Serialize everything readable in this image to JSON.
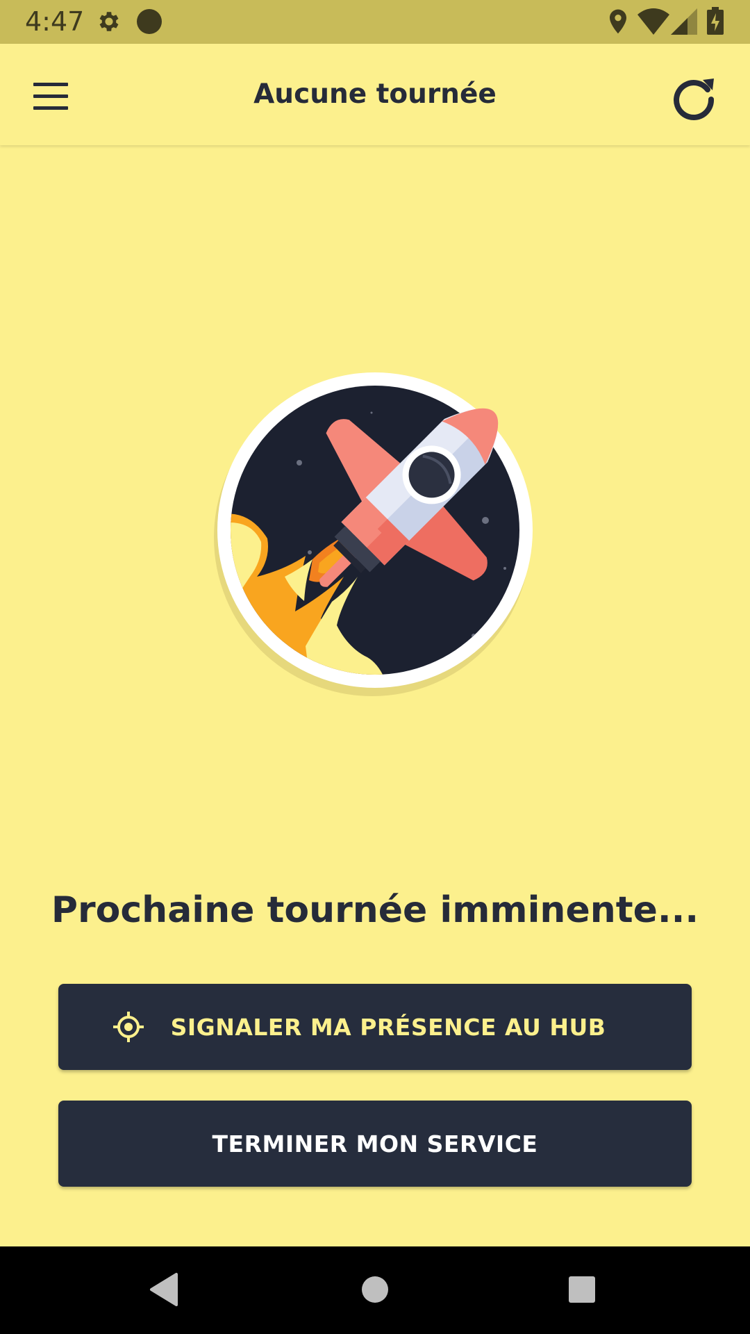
{
  "status_bar": {
    "time": "4:47",
    "icons": [
      "gear-icon",
      "circle-notification-icon",
      "location-icon",
      "wifi-icon",
      "signal-icon",
      "battery-charging-icon"
    ]
  },
  "app_bar": {
    "title": "Aucune tournée",
    "menu_icon": "menu-icon",
    "refresh_icon": "refresh-icon"
  },
  "illustration": {
    "icon": "rocket-illustration"
  },
  "main": {
    "headline": "Prochaine tournée imminente...",
    "buttons": [
      {
        "label": "SIGNALER MA PRÉSENCE AU HUB",
        "icon": "target-icon"
      },
      {
        "label": "TERMINER MON SERVICE"
      }
    ]
  },
  "nav_bar": {
    "icons": [
      "back-icon",
      "home-icon",
      "recents-icon"
    ]
  },
  "colors": {
    "background": "#FCF08D",
    "status_bar": "#C8BB59",
    "button": "#262D3D",
    "button_accent_text": "#FCF08D",
    "text_dark": "#262B39"
  }
}
